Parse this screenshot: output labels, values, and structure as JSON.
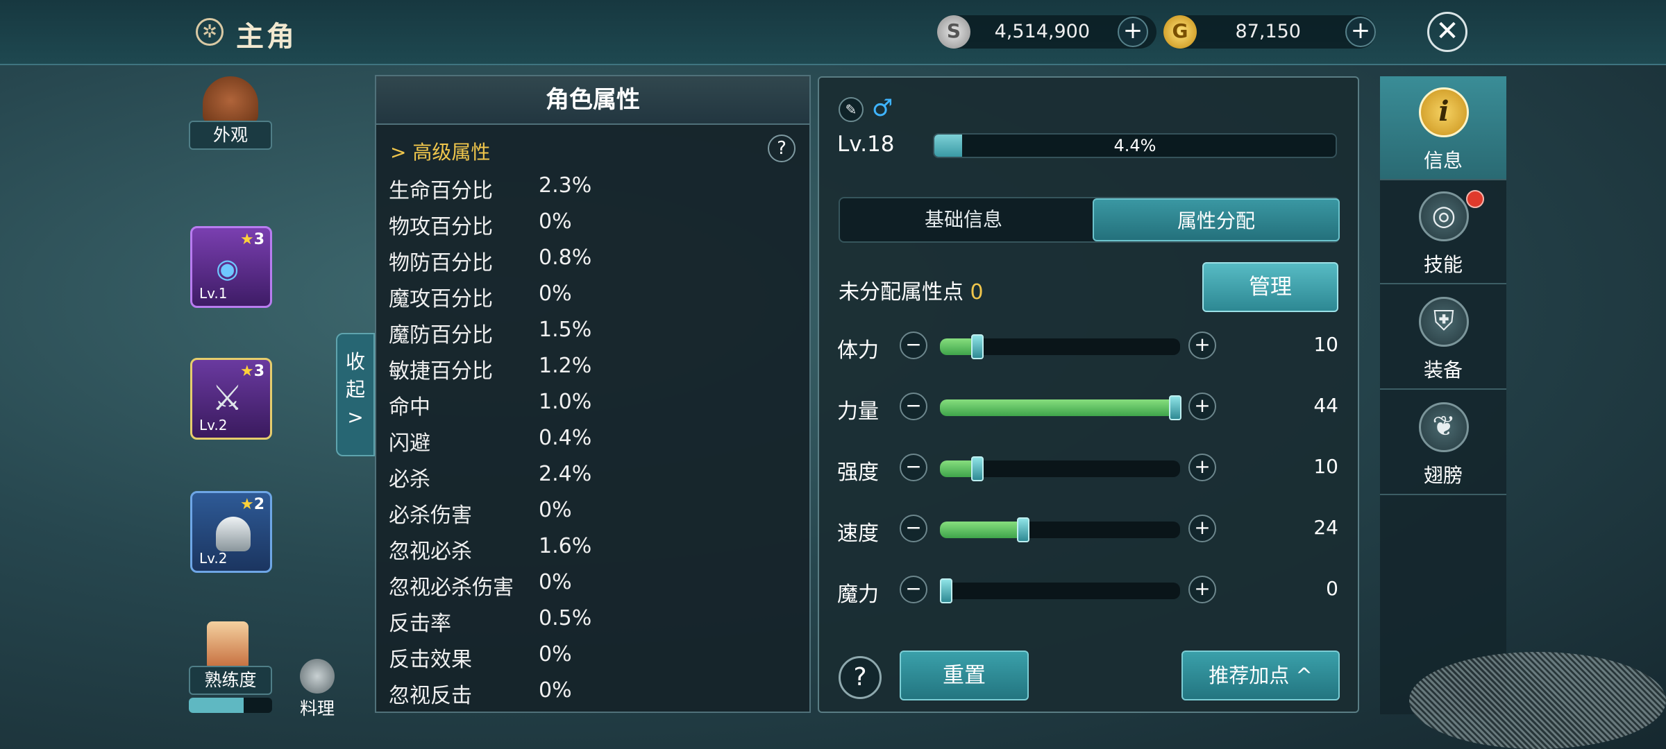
{
  "header": {
    "title": "主角",
    "title_icon": "gear-badge-icon"
  },
  "currency": {
    "silver": "4,514,900",
    "gold": "87,150",
    "plus": "+",
    "silver_icon": "silver-coin-icon",
    "gold_icon": "gold-coin-icon"
  },
  "close_icon": "close-icon",
  "left": {
    "appearance_label": "外观",
    "slots": [
      {
        "stars": "3",
        "level": "Lv.1",
        "icon": "orb-necklace-icon"
      },
      {
        "stars": "3",
        "level": "Lv.2",
        "icon": "battle-axe-icon"
      },
      {
        "stars": "2",
        "level": "Lv.2",
        "icon": "knight-helmet-icon"
      }
    ],
    "proficiency_label": "熟练度",
    "cooking_label": "料理"
  },
  "collapse": {
    "line1": "收",
    "line2": "起",
    "arrow": ">"
  },
  "attributes": {
    "title": "角色属性",
    "section": "高级属性",
    "section_arrow": ">",
    "help": "?",
    "rows": [
      {
        "name": "生命百分比",
        "value": "2.3%"
      },
      {
        "name": "物攻百分比",
        "value": "0%"
      },
      {
        "name": "物防百分比",
        "value": "0.8%"
      },
      {
        "name": "魔攻百分比",
        "value": "0%"
      },
      {
        "name": "魔防百分比",
        "value": "1.5%"
      },
      {
        "name": "敏捷百分比",
        "value": "1.2%"
      },
      {
        "name": "命中",
        "value": "1.0%"
      },
      {
        "name": "闪避",
        "value": "0.4%"
      },
      {
        "name": "必杀",
        "value": "2.4%"
      },
      {
        "name": "必杀伤害",
        "value": "0%"
      },
      {
        "name": "忽视必杀",
        "value": "1.6%"
      },
      {
        "name": "忽视必杀伤害",
        "value": "0%"
      },
      {
        "name": "反击率",
        "value": "0.5%"
      },
      {
        "name": "反击效果",
        "value": "0%"
      },
      {
        "name": "忽视反击",
        "value": "0%"
      }
    ]
  },
  "info": {
    "gender_symbol": "♂",
    "level": "Lv.18",
    "xp_text": "4.4%",
    "xp_fraction": 0.044,
    "tabs": [
      "基础信息",
      "属性分配"
    ],
    "unallocated_label": "未分配属性点",
    "unallocated_value": "0",
    "manage_label": "管理",
    "stats": [
      {
        "name": "体力",
        "value": "10",
        "fill": 0.16
      },
      {
        "name": "力量",
        "value": "44",
        "fill": 1.0
      },
      {
        "name": "强度",
        "value": "10",
        "fill": 0.16
      },
      {
        "name": "速度",
        "value": "24",
        "fill": 0.35
      },
      {
        "name": "魔力",
        "value": "0",
        "fill": 0.0
      }
    ],
    "minus": "−",
    "plus": "+",
    "help": "?",
    "reset_label": "重置",
    "recommend_label": "推荐加点 ^"
  },
  "nav": [
    {
      "label": "信息",
      "icon": "info-icon",
      "glyph": "i"
    },
    {
      "label": "技能",
      "icon": "skill-swirl-icon",
      "glyph": "◎"
    },
    {
      "label": "装备",
      "icon": "armor-icon",
      "glyph": "⛨"
    },
    {
      "label": "翅膀",
      "icon": "wing-icon",
      "glyph": "❦"
    }
  ]
}
